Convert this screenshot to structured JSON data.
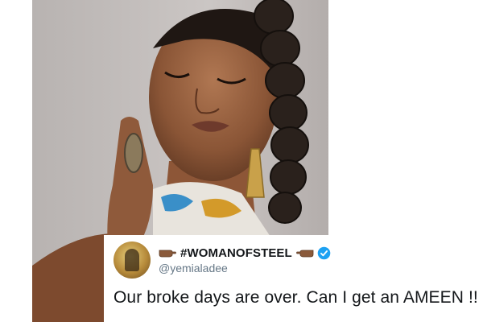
{
  "tweet": {
    "display_name": "#WOMANOFSTEEL",
    "handle": "@yemialadee",
    "text": "Our broke days are over. Can I get an AMEEN !!",
    "verified": true,
    "name_decoration_icon": "backhand-index-pointing-right-icon"
  },
  "colors": {
    "text_primary": "#14171a",
    "text_secondary": "#657786",
    "verified_blue": "#1da1f2",
    "photo_background": "#c4bfbd"
  },
  "photo": {
    "subject": "portrait-photo"
  }
}
